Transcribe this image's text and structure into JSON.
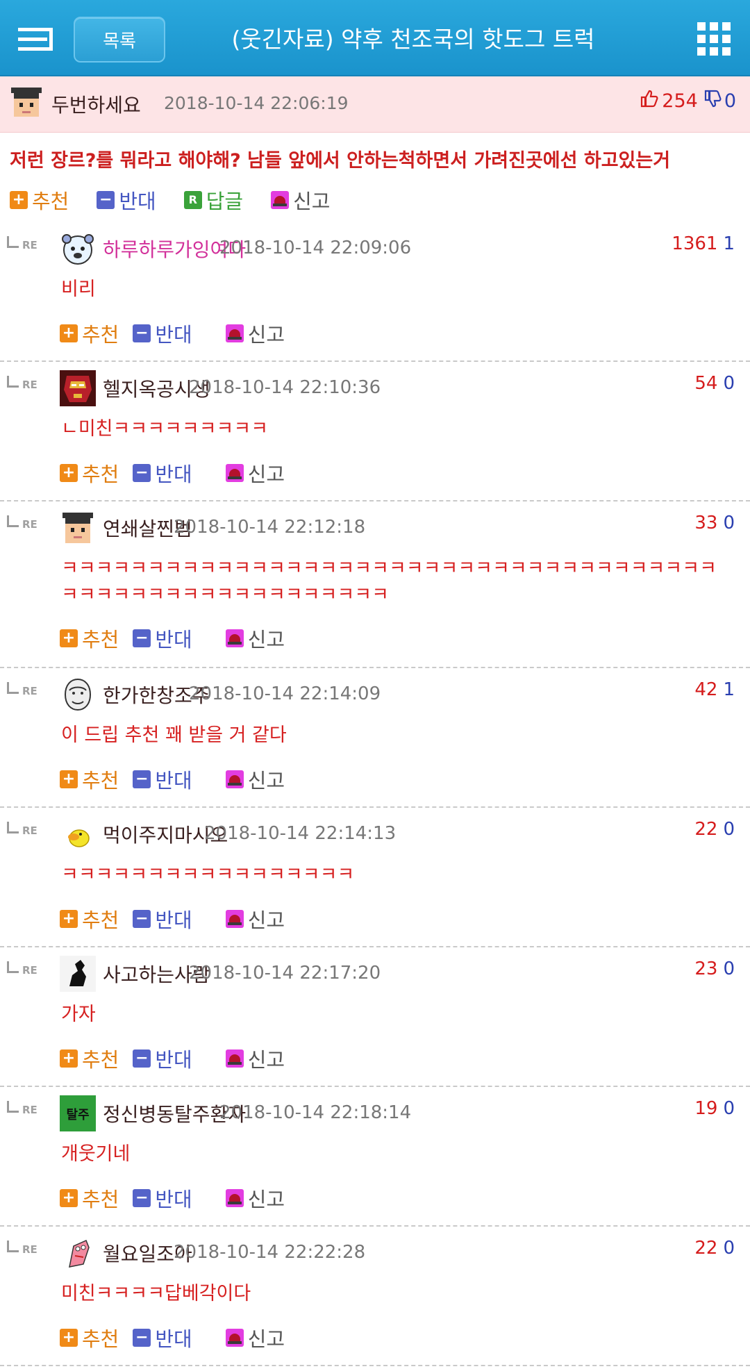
{
  "header": {
    "list_button": "목록",
    "title": "(웃긴자료) 약후 천조국의 핫도그 트럭"
  },
  "post": {
    "user": "두번하세요",
    "date": "2018-10-14 22:06:19",
    "up": "254",
    "down": "0",
    "body": "저런 장르?를 뭐라고 해야해? 남들 앞에서 안하는척하면서 가려진곳에선 하고있는거",
    "actions": {
      "recommend": "추천",
      "oppose": "반대",
      "reply": "답글",
      "report": "신고",
      "reply_badge": "R"
    }
  },
  "re_label": "RE",
  "comments": [
    {
      "user": "하루하루가잉여다",
      "user_color": "#d2309a",
      "date": "2018-10-14 22:09:06",
      "up": "1361",
      "down": "1",
      "text": "비리"
    },
    {
      "user": "헬지옥공시생",
      "user_color": "#3a2020",
      "date": "2018-10-14 22:10:36",
      "up": "54",
      "down": "0",
      "text": "ㄴ미친ㅋㅋㅋㅋㅋㅋㅋㅋㅋ"
    },
    {
      "user": "연쇄살찐범",
      "user_color": "#3a2020",
      "date": "2018-10-14 22:12:18",
      "up": "33",
      "down": "0",
      "text": "ㅋㅋㅋㅋㅋㅋㅋㅋㅋㅋㅋㅋㅋㅋㅋㅋㅋㅋㅋㅋㅋㅋㅋㅋㅋㅋㅋㅋㅋㅋㅋㅋㅋㅋㅋㅋㅋㅋㅋㅋㅋㅋㅋㅋㅋㅋㅋㅋㅋㅋㅋㅋㅋㅋㅋㅋㅋ"
    },
    {
      "user": "한가한창조주",
      "user_color": "#3a2020",
      "date": "2018-10-14 22:14:09",
      "up": "42",
      "down": "1",
      "text": "이 드립 추천 꽤 받을 거 같다"
    },
    {
      "user": "먹이주지마시오",
      "user_color": "#3a2020",
      "date": "2018-10-14 22:14:13",
      "up": "22",
      "down": "0",
      "text": "ㅋㅋㅋㅋㅋㅋㅋㅋㅋㅋㅋㅋㅋㅋㅋㅋㅋ"
    },
    {
      "user": "사고하는사람",
      "user_color": "#3a2020",
      "date": "2018-10-14 22:17:20",
      "up": "23",
      "down": "0",
      "text": "가자"
    },
    {
      "user": "정신병동탈주환자",
      "user_color": "#3a2020",
      "date": "2018-10-14 22:18:14",
      "up": "19",
      "down": "0",
      "text": "개웃기네"
    },
    {
      "user": "월요일조아",
      "user_color": "#3a2020",
      "date": "2018-10-14 22:22:28",
      "up": "22",
      "down": "0",
      "text": "미친ㅋㅋㅋㅋ답베각이다"
    }
  ],
  "avatars": {
    "tile_text": "탈주"
  },
  "colors": {
    "header": "#1a93cc",
    "post_bg": "#fde4e6",
    "up": "#d51c1c",
    "down": "#2a3fb0",
    "comment_text": "#d62020"
  }
}
